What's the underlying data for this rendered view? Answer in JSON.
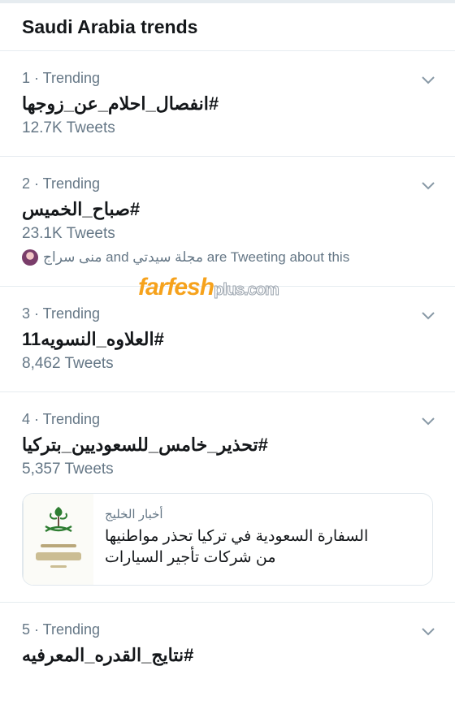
{
  "header": {
    "title": "Saudi Arabia trends"
  },
  "trends": [
    {
      "meta": "1 · Trending",
      "name": "#انفصال_احلام_عن_زوجها",
      "count": "12.7K Tweets"
    },
    {
      "meta": "2 · Trending",
      "name": "#صباح_الخميس",
      "count": "23.1K Tweets",
      "context": "منى سراج and مجلة سيدتي are Tweeting about this"
    },
    {
      "meta": "3 · Trending",
      "name": "#العلاوه_النسويه11",
      "count": "8,462 Tweets"
    },
    {
      "meta": "4 · Trending",
      "name": "#تحذير_خامس_للسعوديين_بتركيا",
      "count": "5,357 Tweets",
      "card": {
        "source": "أخبار الخليج",
        "title_line1": "السفارة السعودية في تركيا تحذر مواطنيها",
        "title_line2": "من  شركات تأجير السيارات"
      }
    },
    {
      "meta": "5 · Trending",
      "name": "#نتايج_القدره_المعرفيه"
    }
  ],
  "watermark": {
    "main": "farfesh",
    "suffix": "plus.com"
  },
  "icons": {
    "more": "chevron-down-icon",
    "avatar": "avatar",
    "card_thumb": "saudi-emblem-icon"
  },
  "colors": {
    "secondary_text": "#657786",
    "divider": "#e6ecf0",
    "watermark": "#f6a21c"
  }
}
